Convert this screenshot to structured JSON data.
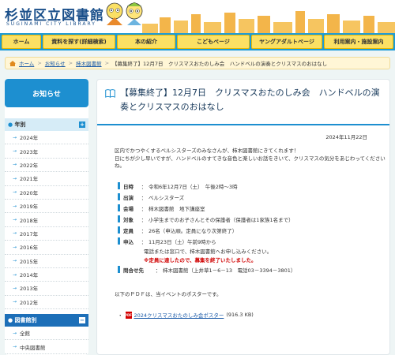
{
  "header": {
    "title": "杉並区立図書館",
    "subtitle": "SUGINAMI CITY LIBRARY"
  },
  "nav": {
    "items": [
      {
        "label": "ホーム"
      },
      {
        "label": "資料を探す(詳細検索)"
      },
      {
        "label": "本の紹介"
      },
      {
        "label": "こどもページ"
      },
      {
        "label": "ヤングアダルトページ"
      },
      {
        "label": "利用案内・施設案内"
      }
    ]
  },
  "breadcrumb": {
    "home": "ホーム",
    "news": "お知らせ",
    "branch": "柿木図書館",
    "current": "【募集終了】12月7日　クリスマスおたのしみ会　ハンドベルの演奏とクリスマスのおはなし",
    "sep": ">"
  },
  "sidebar": {
    "heading": "お知らせ",
    "group1": "年別",
    "years": [
      "2024年",
      "2023年",
      "2022年",
      "2021年",
      "2020年",
      "2019年",
      "2018年",
      "2017年",
      "2016年",
      "2015年",
      "2014年",
      "2013年",
      "2012年"
    ],
    "group2": "図書館別",
    "branches": [
      "全館",
      "中央図書館"
    ],
    "toggle_plus": "+",
    "toggle_minus": "−",
    "arrow": "→"
  },
  "article": {
    "title": "【募集終了】12月7日　クリスマスおたのしみ会　ハンドベルの演奏とクリスマスのおはなし",
    "date": "2024年11月22日",
    "intro1": "区内でかつやくするベルシスターズのみなさんが、柿木図書館にきてくれます！",
    "intro2": "日にちが少し早いですが、ハンドベルのすてきな音色と楽しいお話をきいて、クリスマスの気分をあじわってください",
    "intro3": "ね。",
    "rows": [
      {
        "label": "日時",
        "value": "令和6年12月7日（土）　午後2時～3時"
      },
      {
        "label": "出演",
        "value": "ベルシスターズ"
      },
      {
        "label": "会場",
        "value": "柿木図書館　地下講座室"
      },
      {
        "label": "対象",
        "value": "小学生までのお子さんとその保護者（保護者は1家族1名まで）"
      },
      {
        "label": "定員",
        "value": "26名（申込順。定員になり次第終了）"
      },
      {
        "label": "申込",
        "value": "11月23日（土）午前9時から"
      }
    ],
    "note1": "電話または窓口で、柿木図書館へお申し込みください。",
    "note2": "※定員に達したので、募集を終了いたしました。",
    "contact_label": "問合せ先",
    "contact_value": "柿木図書館（上井草1－6－13　電話03－3394－3801）",
    "colon": "：",
    "poster_note": "以下のＰＤＦは、当イベントのポスターです。",
    "bullet": "・",
    "pdf_badge": "PDF",
    "pdf_link": "2024クリスマスおたのしみ会ポスター",
    "pdf_size": "(916.3 KB)"
  },
  "colors": {
    "nav_bg": "#1d9bd6",
    "nav_btn": "#fbe064",
    "accent_blue": "#1d8fd0",
    "alert_red": "#d00000"
  }
}
